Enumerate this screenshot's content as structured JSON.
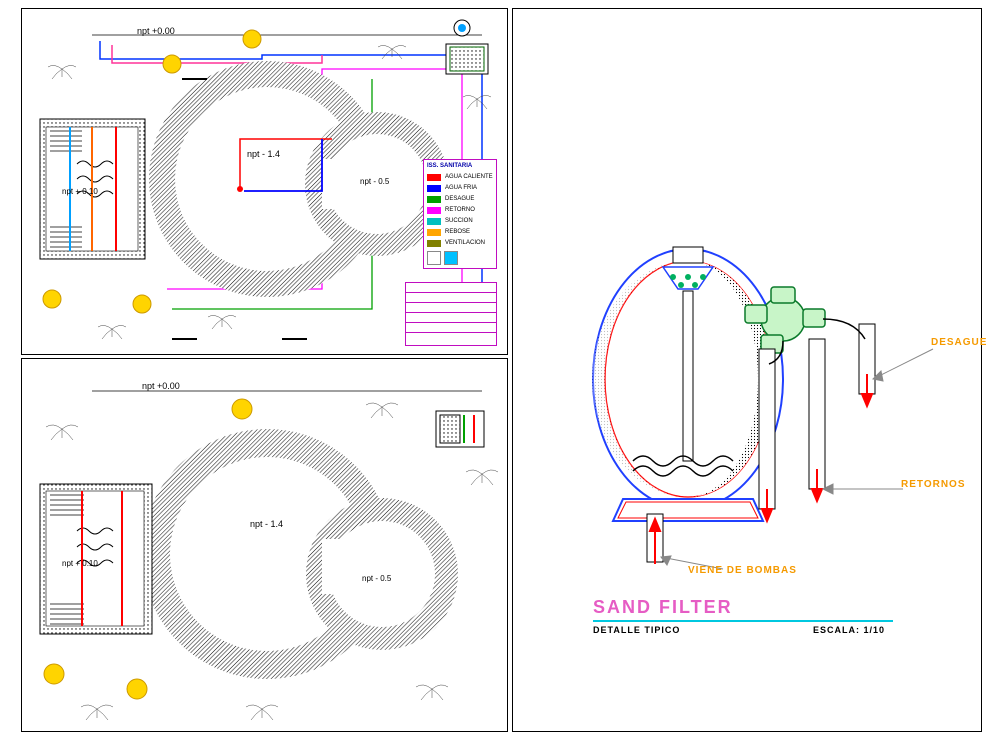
{
  "panels": {
    "top_plan": {
      "npt_datum": "npt +0.00",
      "npt_main": "npt - 1.4",
      "npt_small": "npt - 0.5",
      "npt_deck": "npt + 0.10"
    },
    "bottom_plan": {
      "npt_datum": "npt +0.00",
      "npt_main": "npt - 1.4",
      "npt_small": "npt - 0.5",
      "npt_deck": "npt + 0.10"
    },
    "filter_detail": {
      "title": "SAND FILTER",
      "subtitle_left": "DETALLE TIPICO",
      "subtitle_right": "ESCALA: 1/10",
      "callout_desague": "DESAGUE",
      "callout_retornos": "RETORNOS",
      "callout_bombas": "VIENE DE BOMBAS"
    }
  },
  "legend": {
    "header": "ISS. SANITARIA",
    "rows": [
      {
        "color": "#ff0000",
        "label": "AGUA CALIENTE"
      },
      {
        "color": "#0000ff",
        "label": "AGUA FRIA"
      },
      {
        "color": "#00a000",
        "label": "DESAGUE"
      },
      {
        "color": "#ff00ff",
        "label": "RETORNO"
      },
      {
        "color": "#00c0c0",
        "label": "SUCCION"
      },
      {
        "color": "#ffa500",
        "label": "REBOSE"
      },
      {
        "color": "#808000",
        "label": "VENTILACION"
      }
    ]
  },
  "symbols": {
    "sun": "sun-symbol",
    "palm": "palm-symbol"
  }
}
